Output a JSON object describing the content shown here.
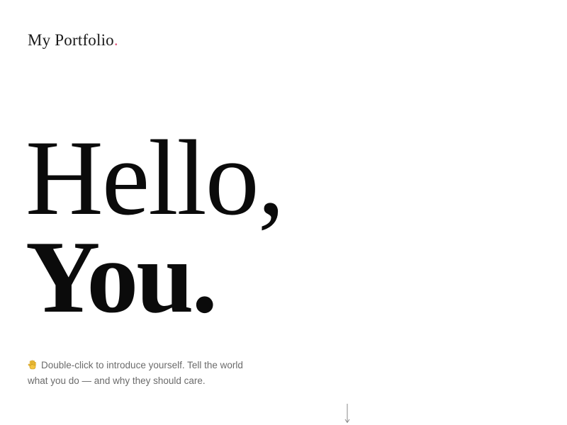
{
  "header": {
    "site_title": "My Portfolio",
    "site_title_dot": ".",
    "accent_color": "#e0557a"
  },
  "hero": {
    "line1": "Hello,",
    "line2": "You."
  },
  "intro": {
    "icon": "waving-hand-icon",
    "text": "Double-click to introduce yourself. Tell the world what you do — and why they should care."
  },
  "scroll_indicator": {
    "icon": "arrow-down-icon"
  }
}
